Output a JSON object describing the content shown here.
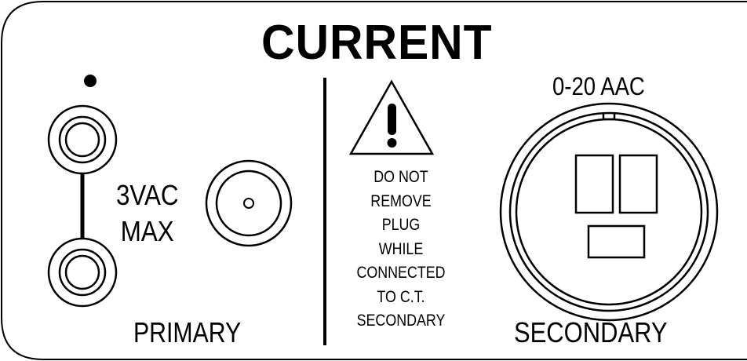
{
  "panel": {
    "title": "CURRENT",
    "range": "0-20 AAC",
    "rating": [
      "3VAC",
      "MAX"
    ],
    "primary_label": "PRIMARY",
    "secondary_label": "SECONDARY",
    "warning": [
      "DO NOT",
      "REMOVE",
      "PLUG",
      "WHILE",
      "CONNECTED",
      "TO C.T.",
      "SECONDARY"
    ]
  },
  "icons": {
    "polarity": "polarity-dot-icon",
    "warning": "warning-triangle-icon",
    "primary_jacks": "binding-post-icon",
    "bnc": "bnc-connector-icon",
    "secondary": "ct-connector-icon"
  },
  "colors": {
    "ink": "#000000",
    "background": "#ffffff"
  }
}
